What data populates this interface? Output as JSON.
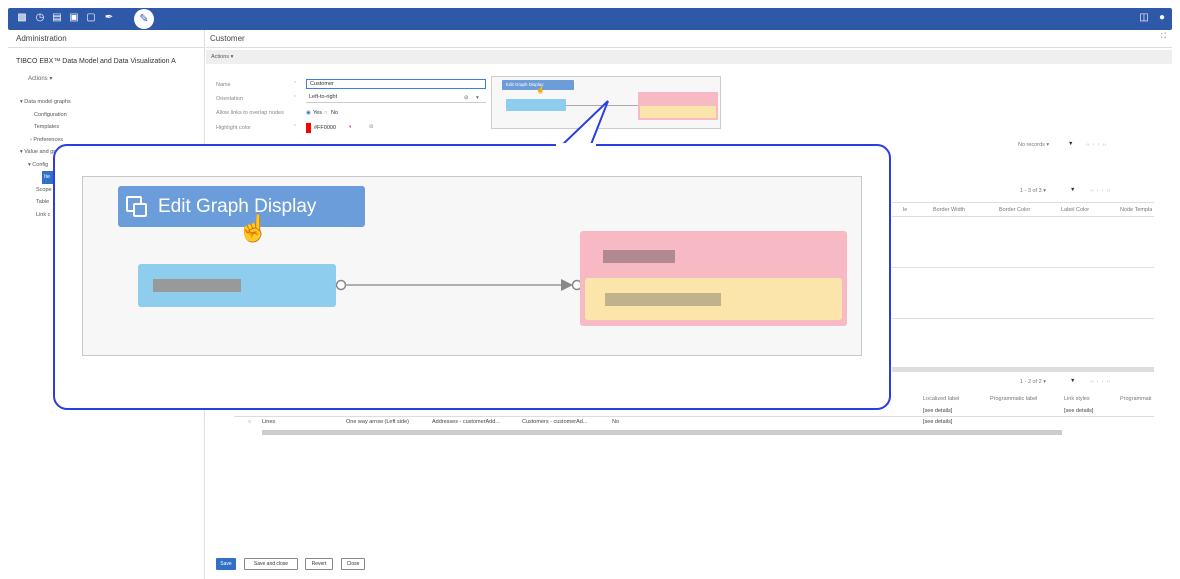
{
  "colors": {
    "topbar": "#2d59a8",
    "accent": "#3270c8",
    "callout_border": "#2b3ee0",
    "node_blue": "#8fcdee",
    "node_pink": "#f7b9c4",
    "node_yellow": "#fce5aa",
    "highlight": "#FF0000"
  },
  "topbar": {
    "icons": [
      "database-icon",
      "clock-icon",
      "copy-icon",
      "file-icon",
      "export-icon",
      "pin-icon",
      "wrench-icon"
    ]
  },
  "left": {
    "header": "Administration",
    "title": "TIBCO EBX™ Data Model and Data Visualization A",
    "actions": "Actions ▾",
    "tree": {
      "data_model_graphs": "▾ Data model graphs",
      "configuration": "Configuration",
      "templates": "Templates",
      "preferences": "› Preferences",
      "value_and": "▾ Value and gr",
      "config2": "▾ Config",
      "item_sel": "Ite",
      "scope": "Scope",
      "table": "Table",
      "link": "Link c"
    }
  },
  "main": {
    "header": "Customer",
    "actions": "Actions ▾",
    "form": {
      "name_label": "Name",
      "name_value": "Customer",
      "orientation_label": "Orientation",
      "orientation_value": "Left-to-right",
      "overlap_label": "Allow links to overlap nodes",
      "yes": "Yes",
      "no": "No",
      "highlight_label": "Highlight color",
      "highlight_value": "#FF0000"
    },
    "preview_btn": "Edit Graph Display",
    "grid1": {
      "pager": "No records ▾"
    },
    "grid2": {
      "pager": "1 - 3 of 3 ▾",
      "columns": [
        "Border Width",
        "Border Color",
        "Label Color",
        "Node Templa"
      ]
    },
    "grid3": {
      "pager": "1 - 2 of 2 ▾",
      "columns": [
        "Localized label",
        "Programmatic label",
        "Link styles",
        "Programmati"
      ],
      "row_see": "[see details]",
      "row": {
        "name": "Lines",
        "style": "One way arrow (Left side)",
        "source": "Addresses - customerAdd...",
        "target": "Customers - customerAd...",
        "flag": "No",
        "details": "[see details]"
      }
    },
    "buttons": {
      "save": "Save",
      "save_close": "Save and close",
      "revert": "Revert",
      "close": "Close"
    }
  },
  "zoom": {
    "button": "Edit Graph Display"
  }
}
